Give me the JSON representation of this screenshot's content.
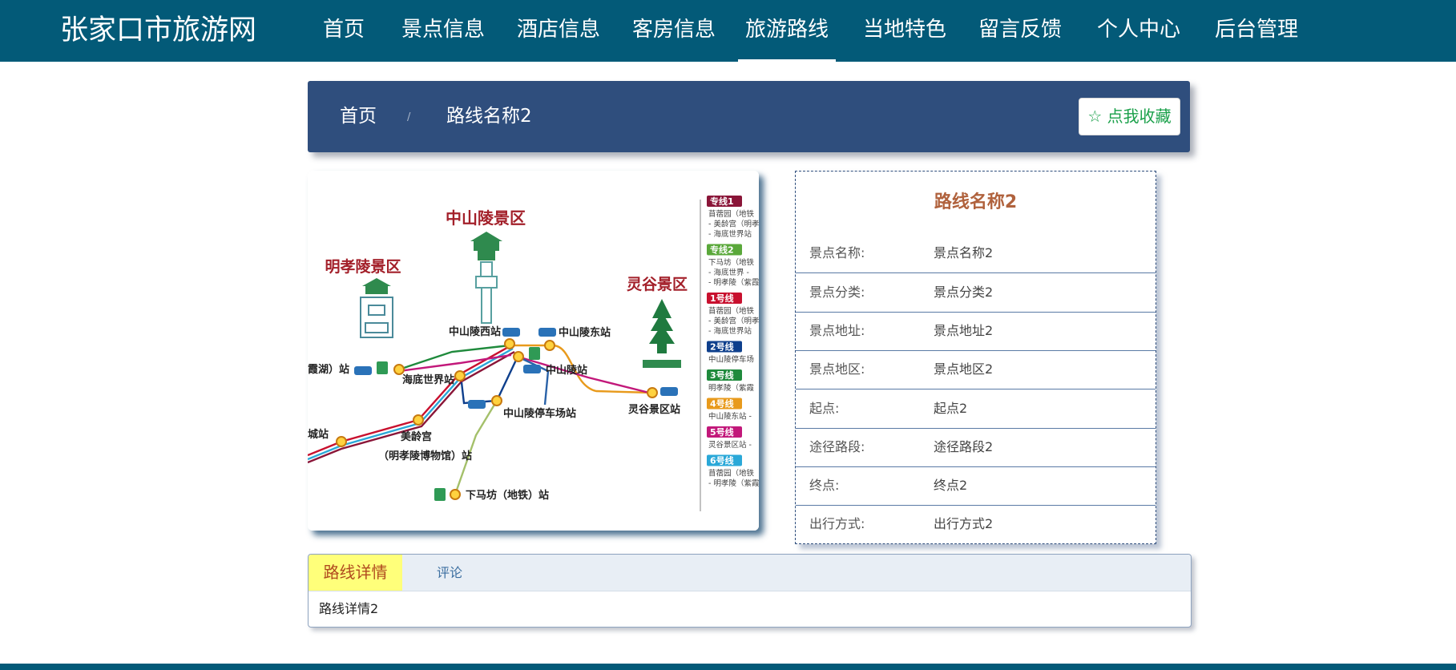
{
  "site": {
    "title": "张家口市旅游网"
  },
  "nav": {
    "items": [
      {
        "label": "首页"
      },
      {
        "label": "景点信息"
      },
      {
        "label": "酒店信息"
      },
      {
        "label": "客房信息"
      },
      {
        "label": "旅游路线",
        "active": true
      },
      {
        "label": "当地特色"
      },
      {
        "label": "留言反馈"
      },
      {
        "label": "个人中心"
      },
      {
        "label": "后台管理"
      }
    ]
  },
  "breadcrumb": {
    "home": "首页",
    "separator": "/",
    "current": "路线名称2"
  },
  "favorite": {
    "label": "☆ 点我收藏"
  },
  "route_map": {
    "areas": [
      "中山陵景区",
      "明孝陵景区",
      "灵谷景区"
    ],
    "stations": [
      "中山陵西站",
      "中山陵东站",
      "中山陵站",
      "海底世界站",
      "霞湖）站",
      "中山陵停车场站",
      "灵谷景区站",
      "美龄宫",
      "（明孝陵博物馆）站",
      "下马坊（地铁）站",
      "城站"
    ],
    "legend": [
      {
        "name": "专线1",
        "color": "#8a1538",
        "lines": [
          "苜蓿园（地铁",
          "- 美龄宫（明孝",
          "- 海底世界站"
        ]
      },
      {
        "name": "专线2",
        "color": "#5aa83a",
        "lines": [
          "下马坊（地铁",
          "- 海底世界 -",
          "- 明孝陵（紫霞"
        ]
      },
      {
        "name": "1号线",
        "color": "#c8102e",
        "lines": [
          "苜蓿园（地铁",
          "- 美龄宫（明孝",
          "- 海底世界站"
        ]
      },
      {
        "name": "2号线",
        "color": "#0e3f8c",
        "lines": [
          "中山陵停车场"
        ]
      },
      {
        "name": "3号线",
        "color": "#1f8a3c",
        "lines": [
          "明孝陵（紫霞"
        ]
      },
      {
        "name": "4号线",
        "color": "#e89a1c",
        "lines": [
          "中山陵东站 -"
        ]
      },
      {
        "name": "5号线",
        "color": "#c2187a",
        "lines": [
          "灵谷景区站 -"
        ]
      },
      {
        "name": "6号线",
        "color": "#2aa8d8",
        "lines": [
          "苜蓿园（地铁",
          "- 明孝陵（紫霞"
        ]
      }
    ]
  },
  "info": {
    "title": "路线名称2",
    "rows": [
      {
        "label": "景点名称:",
        "value": "景点名称2"
      },
      {
        "label": "景点分类:",
        "value": "景点分类2"
      },
      {
        "label": "景点地址:",
        "value": "景点地址2"
      },
      {
        "label": "景点地区:",
        "value": "景点地区2"
      },
      {
        "label": "起点:",
        "value": "起点2"
      },
      {
        "label": "途径路段:",
        "value": "途径路段2"
      },
      {
        "label": "终点:",
        "value": "终点2"
      },
      {
        "label": "出行方式:",
        "value": "出行方式2"
      }
    ]
  },
  "tabs": {
    "items": [
      {
        "label": "路线详情",
        "active": true
      },
      {
        "label": "评论"
      }
    ],
    "content": "路线详情2"
  },
  "colors": {
    "nav_bg": "#035a78",
    "crumb_bg": "#2f4e7d",
    "title_accent": "#b0623d",
    "favorite_text": "#1aa04a",
    "active_tab_bg": "#ffff7a"
  }
}
